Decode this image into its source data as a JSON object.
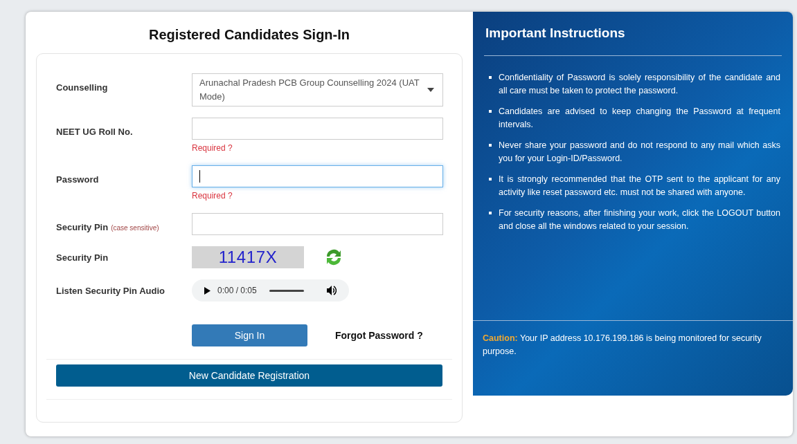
{
  "sign_in": {
    "title": "Registered Candidates Sign-In",
    "fields": [
      {
        "kind": "select",
        "label": "Counselling",
        "value": "Arunachal Pradesh PCB Group Counselling 2024 (UAT Mode)"
      },
      {
        "kind": "input",
        "label": "NEET UG Roll No.",
        "error": "Required ?",
        "focused": false
      },
      {
        "kind": "input",
        "label": "Password",
        "error": "Required ?",
        "focused": true
      },
      {
        "kind": "input",
        "label": "Security Pin",
        "hint": "(case sensitive)",
        "focused": false
      },
      {
        "kind": "captcha",
        "label": "Security Pin",
        "captcha": "11417X"
      },
      {
        "kind": "audio",
        "label": "Listen Security Pin Audio",
        "time": "0:00 / 0:05"
      }
    ],
    "sign_in_button": "Sign In",
    "forgot_link": "Forgot Password ?",
    "register_button": "New Candidate Registration"
  },
  "instructions": {
    "title": "Important Instructions",
    "items": [
      "Confidentiality of Password is solely responsibility of the candidate and all care must be taken to protect the password.",
      "Candidates are advised to keep changing the Password at frequent intervals.",
      "Never share your password and do not respond to any mail which asks you for your Login-ID/Password.",
      "It is strongly recommended that the OTP sent to the applicant for any activity like reset password etc. must not be shared with anyone.",
      "For security reasons, after finishing your work, click the LOGOUT button and close all the windows related to your session."
    ],
    "caution": {
      "label": "Caution:",
      "text": "Your IP address 10.176.199.186 is being monitored for security purpose."
    }
  }
}
